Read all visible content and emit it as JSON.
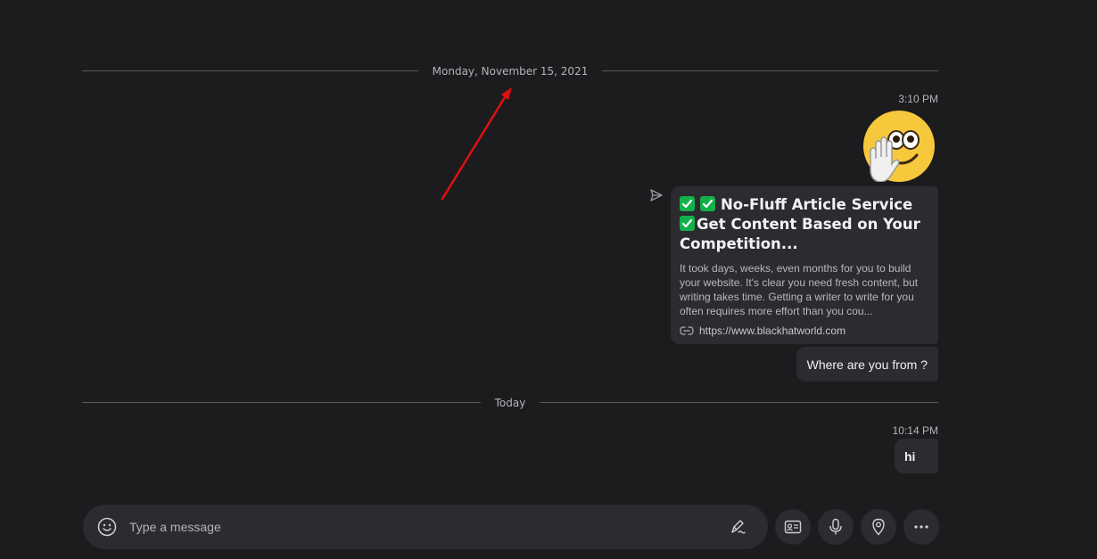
{
  "dividers": {
    "first_date": "Monday, November 15, 2021",
    "today": "Today"
  },
  "messages": {
    "first_time": "3:10 PM",
    "link_card": {
      "title_line1": "No-Fluff Article Service",
      "title_line2": "Get Content Based on Your",
      "title_line3": "Competition...",
      "description": "It took days, weeks, even months for you to build your website.  It's clear you need fresh content, but writing takes time. Getting a writer to write for you often requires more effort than you cou...",
      "url": "https://www.blackhatworld.com"
    },
    "where_text": "Where are you from ?",
    "second_time": "10:14 PM",
    "hi_text": "hi"
  },
  "composer": {
    "placeholder": "Type a message"
  },
  "icons": {
    "emoji": "smile-icon",
    "format": "pen-format-icon",
    "contact": "contact-card-icon",
    "mic": "microphone-icon",
    "location": "location-pin-icon",
    "more": "more-dots-icon",
    "sent": "sent-icon",
    "link": "link-icon"
  },
  "colors": {
    "background": "#1c1c1e",
    "bubble": "#2b2b30",
    "check_green": "#14b14a",
    "annotation_red": "#e01010"
  }
}
